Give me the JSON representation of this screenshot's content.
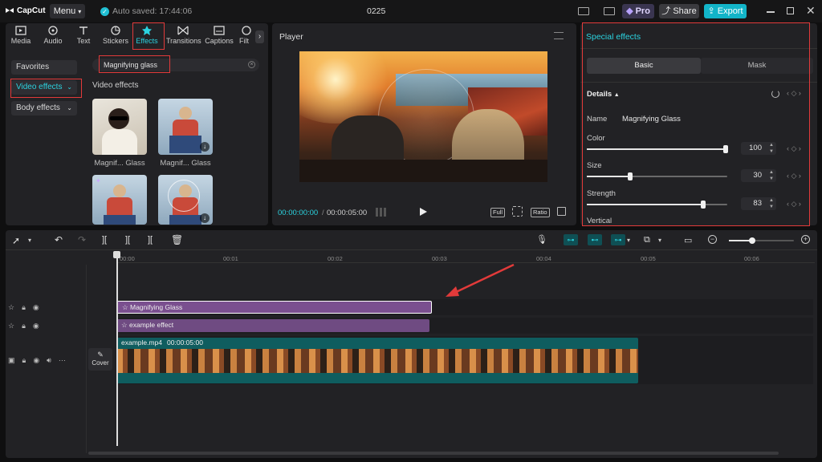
{
  "app": {
    "logo_text": "CapCut",
    "menu_label": "Menu",
    "autosave_text": "Auto saved: 17:44:06",
    "project_title": "0225",
    "pro_label": "Pro",
    "share_label": "Share",
    "export_label": "Export"
  },
  "media_tabs": [
    {
      "label": "Media",
      "icon": "media-icon"
    },
    {
      "label": "Audio",
      "icon": "audio-icon"
    },
    {
      "label": "Text",
      "icon": "text-icon"
    },
    {
      "label": "Stickers",
      "icon": "sticker-icon"
    },
    {
      "label": "Effects",
      "icon": "effects-icon",
      "active": true
    },
    {
      "label": "Transitions",
      "icon": "transitions-icon"
    },
    {
      "label": "Captions",
      "icon": "captions-icon"
    },
    {
      "label": "Filt",
      "icon": "filters-icon"
    }
  ],
  "sidebar": {
    "favorites": "Favorites",
    "video_effects": "Video effects",
    "body_effects": "Body effects"
  },
  "search": {
    "value": "Magnifying glass"
  },
  "effects_section_title": "Video effects",
  "effect_items": [
    {
      "label": "Magnif... Glass"
    },
    {
      "label": "Magnif... Glass"
    },
    {
      "label": ""
    },
    {
      "label": ""
    }
  ],
  "player": {
    "title": "Player",
    "current_time": "00:00:00:00",
    "total_time": "00:00:05:00",
    "full_label": "Full",
    "ratio_label": "Ratio"
  },
  "special": {
    "title": "Special effects",
    "tab_basic": "Basic",
    "tab_mask": "Mask",
    "details_label": "Details",
    "name_label": "Name",
    "name_value": "Magnifying Glass",
    "params": [
      {
        "label": "Color",
        "value": "100",
        "fraction": 1.0
      },
      {
        "label": "Size",
        "value": "30",
        "fraction": 0.3
      },
      {
        "label": "Strength",
        "value": "83",
        "fraction": 0.83
      }
    ],
    "vertical_label": "Vertical"
  },
  "timeline": {
    "ruler": [
      "00:00",
      "00:01",
      "00:02",
      "00:03",
      "00:04",
      "00:05",
      "00:06"
    ],
    "clips": {
      "effect1": "Magnifying Glass",
      "effect2": "example effect",
      "video_name": "example.mp4",
      "video_duration": "00:00:05:00"
    },
    "cover_label": "Cover"
  },
  "colors": {
    "accent": "#2bd3e0",
    "effect_clip": "#7a4f8f",
    "video_clip": "#0f5d5f",
    "annotation": "#e23a3a",
    "export_bg": "#12b4c8"
  }
}
